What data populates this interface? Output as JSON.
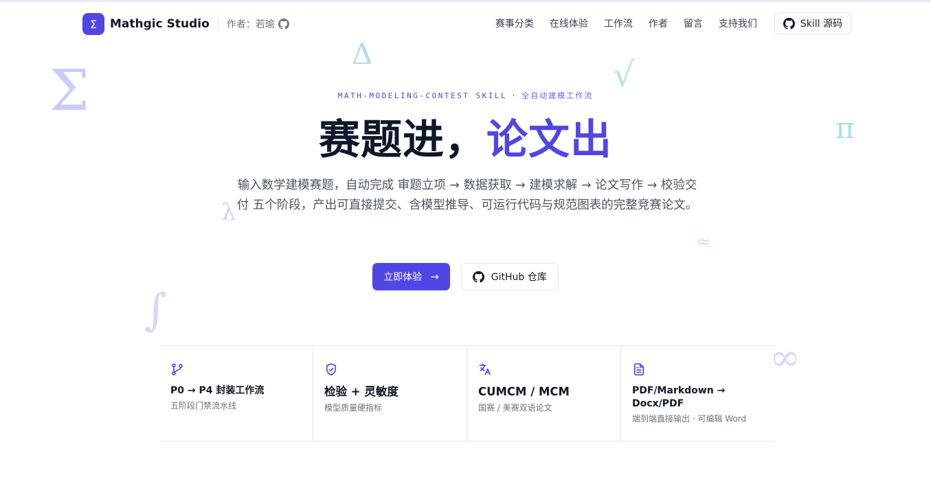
{
  "header": {
    "logo_glyph": "Σ",
    "brand": "Mathgic Studio",
    "author": "作者：若瑜",
    "nav": [
      "赛事分类",
      "在线体验",
      "工作流",
      "作者",
      "留言",
      "支持我们"
    ],
    "skill_button": "Skill 源码"
  },
  "background_symbols": [
    "Σ",
    "Δ",
    "√",
    "π",
    "λ",
    "≈",
    "∫",
    "∞"
  ],
  "hero": {
    "eyebrow_en": "MATH-MODELING-CONTEST SKILL",
    "eyebrow_dot": "·",
    "eyebrow_cn": "全自动建模工作流",
    "title_main": "赛题进，",
    "title_accent": "论文出",
    "description": "输入数学建模赛题，自动完成 审题立项 → 数据获取 → 建模求解 → 论文写作 → 校验交付 五个阶段，产出可直接提交、含模型推导、可运行代码与规范图表的完整竞赛论文。",
    "primary_button": "立即体验",
    "primary_arrow": "→",
    "secondary_button": "GitHub 仓库"
  },
  "features": [
    {
      "icon": "git-branch-icon",
      "title": "P0 → P4 封装工作流",
      "subtitle": "五阶段门禁流水线"
    },
    {
      "icon": "shield-check-icon",
      "title": "检验 + 灵敏度",
      "subtitle": "模型质量硬指标"
    },
    {
      "icon": "translate-icon",
      "title": "CUMCM / MCM",
      "subtitle": "国赛 / 美赛双语论文"
    },
    {
      "icon": "document-icon",
      "title": "PDF/Markdown → Docx/PDF",
      "subtitle": "端到端直接输出 · 可编辑 Word"
    }
  ],
  "colors": {
    "accent": "#4f46e5",
    "text": "#111827",
    "muted": "#6b7280"
  }
}
